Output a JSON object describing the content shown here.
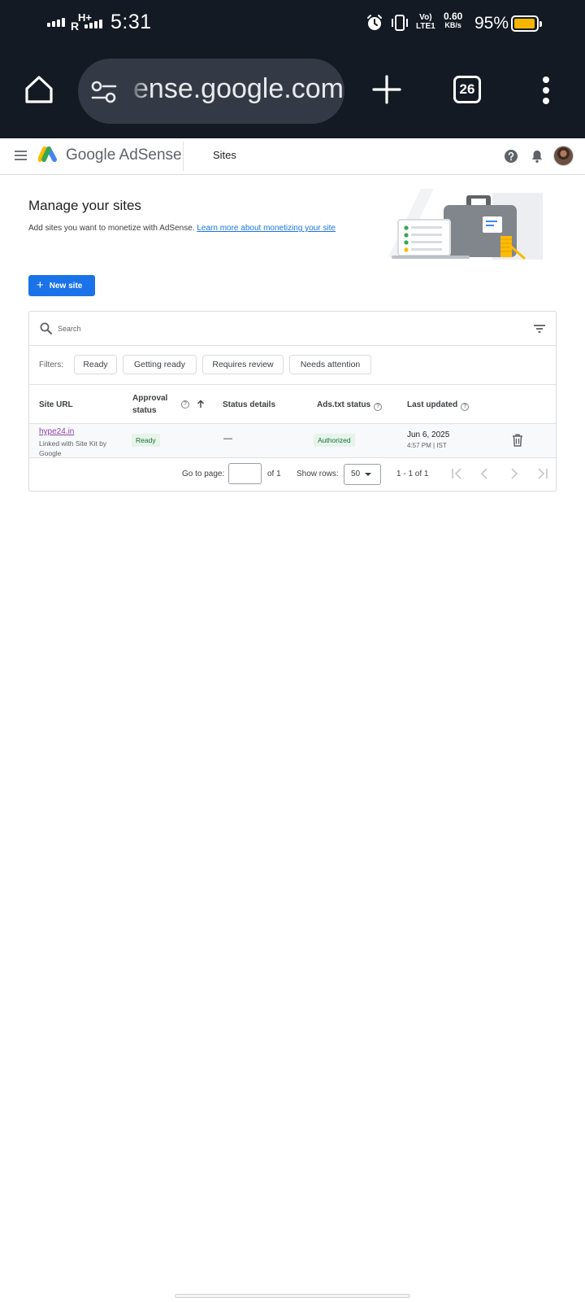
{
  "status_bar": {
    "network_r": "R",
    "network_hplus": "H+",
    "time": "5:31",
    "volte": "Vo)",
    "lte": "LTE1",
    "speed_value": "0.60",
    "speed_unit": "KB/s",
    "battery_percent": "95%",
    "battery_level": 0.95,
    "battery_color": "#f7b500"
  },
  "browser": {
    "url_text": "ense.google.com",
    "tab_count": "26",
    "icons": [
      "home-icon",
      "site-settings-icon",
      "new-tab-icon",
      "tab-switcher-icon",
      "overflow-menu-icon"
    ]
  },
  "header": {
    "brand_google": "Google",
    "brand_product": "AdSense",
    "section": "Sites",
    "accent_color": "#1a73e8"
  },
  "intro": {
    "title": "Manage your sites",
    "description": "Add sites you want to monetize with AdSense.",
    "learn_more_link": "Learn more about monetizing your site",
    "new_site_button": "New site"
  },
  "table": {
    "search_placeholder": "Search",
    "filters_label": "Filters:",
    "filters": [
      "Ready",
      "Getting ready",
      "Requires review",
      "Needs attention"
    ],
    "columns": {
      "site_url": "Site URL",
      "approval_status_1": "Approval",
      "approval_status_2": "status",
      "status_details": "Status details",
      "ads_txt_status": "Ads.txt status",
      "last_updated": "Last updated"
    },
    "rows": [
      {
        "site": "hype24.in",
        "site_sub": "Linked with Site Kit by Google",
        "approval_status": "Ready",
        "status_details": "—",
        "ads_txt_status": "Authorized",
        "last_updated_date": "Jun 6, 2025",
        "last_updated_time": "4:57 PM | IST"
      }
    ],
    "pagination": {
      "go_to_page_label": "Go to page:",
      "go_to_page_value": "",
      "of_pages": "of 1",
      "show_rows_label": "Show rows:",
      "rows_per_page": "50",
      "range": "1 - 1 of 1"
    },
    "status_color": "#137333",
    "status_bg": "#e6f4ea",
    "link_color": "#8e44ad"
  }
}
